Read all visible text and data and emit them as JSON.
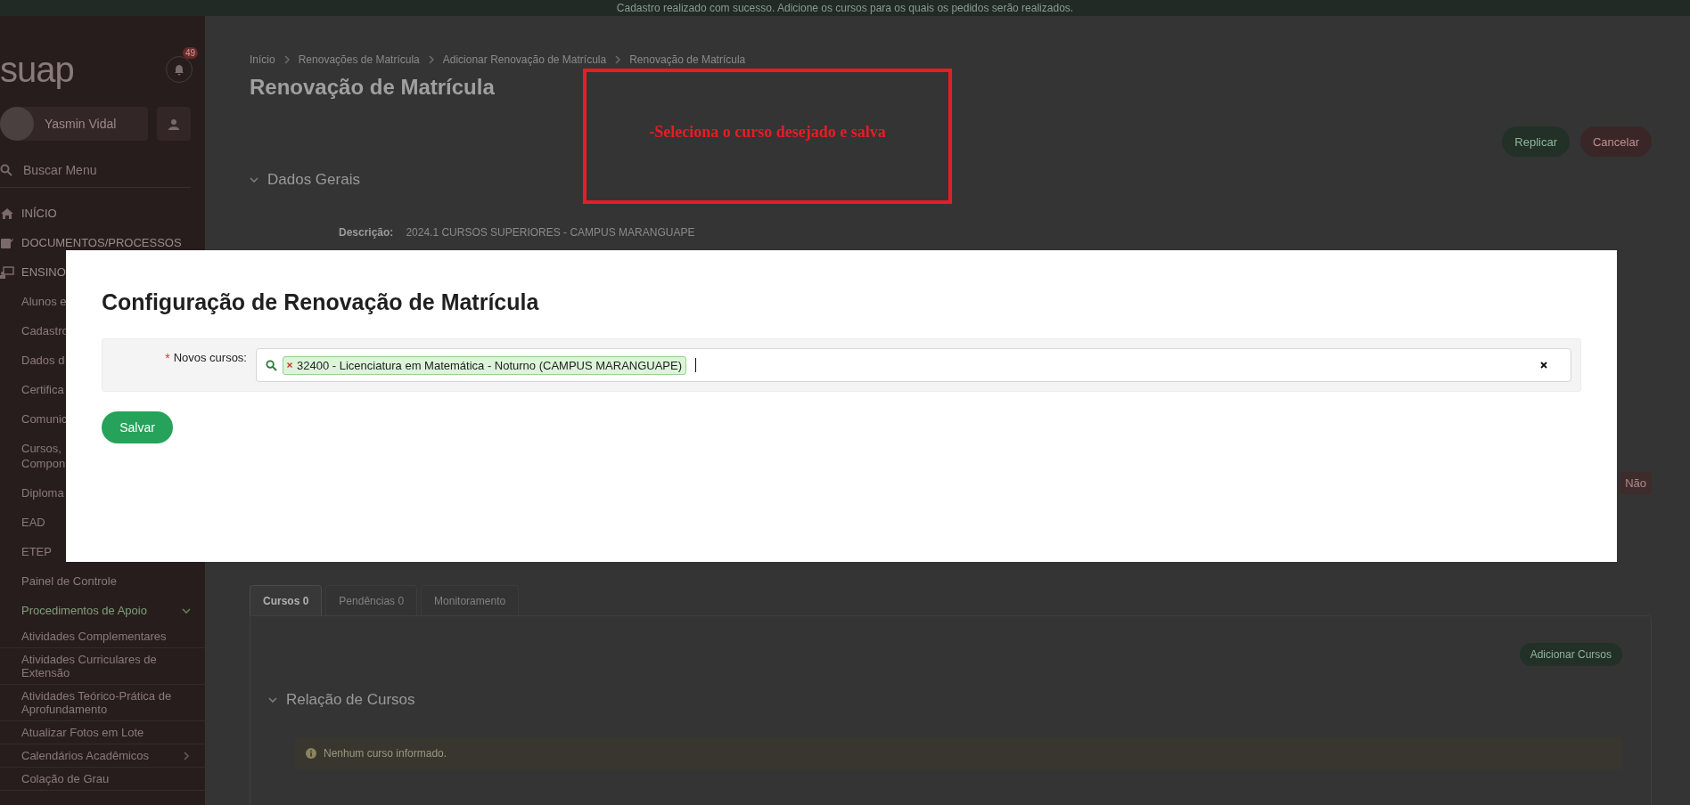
{
  "top_message": "Cadastro realizado com sucesso. Adicione os cursos para os quais os pedidos serão realizados.",
  "sidebar": {
    "logo": "suap",
    "notification_count": "49",
    "user_name": "Yasmin Vidal",
    "search_placeholder": "Buscar Menu",
    "items": [
      {
        "kind": "section",
        "label": "INÍCIO"
      },
      {
        "kind": "section",
        "label": "DOCUMENTOS/PROCESSOS"
      },
      {
        "kind": "section",
        "label": "ENSINO",
        "children": [
          {
            "kind": "link",
            "label": "Alunos e"
          },
          {
            "kind": "link",
            "label": "Cadastro"
          },
          {
            "kind": "link",
            "label": "Dados d"
          },
          {
            "kind": "link",
            "label": "Certifica"
          },
          {
            "kind": "link",
            "label": "Comunic"
          },
          {
            "kind": "link",
            "label": "Cursos,\nCompon"
          },
          {
            "kind": "link",
            "label": "Diploma"
          },
          {
            "kind": "link",
            "label": "EAD"
          },
          {
            "kind": "link",
            "label": "ETEP"
          },
          {
            "kind": "link",
            "label": "Painel de Controle"
          },
          {
            "kind": "group",
            "label": "Procedimentos de Apoio",
            "expanded": true,
            "children": [
              {
                "kind": "link",
                "label": "Atividades Complementares"
              },
              {
                "kind": "link",
                "label": "Atividades Curriculares de Extensão"
              },
              {
                "kind": "link",
                "label": "Atividades Teórico-Prática de Aprofundamento"
              },
              {
                "kind": "link",
                "label": "Atualizar Fotos em Lote"
              },
              {
                "kind": "submenu",
                "label": "Calendários Acadêmicos",
                "expanded": false
              },
              {
                "kind": "link",
                "label": "Colação de Grau"
              }
            ]
          }
        ]
      }
    ]
  },
  "breadcrumbs": [
    "Início",
    "Renovações de Matrícula",
    "Adicionar Renovação de Matrícula",
    "Renovação de Matrícula"
  ],
  "title": "Renovação de Matrícula",
  "actions": [
    {
      "label": "Replicar",
      "kind": "success"
    },
    {
      "label": "Cancelar",
      "kind": "danger"
    }
  ],
  "general_section": {
    "title": "Dados Gerais",
    "expanded": true,
    "fields": [
      {
        "label": "Descrição:",
        "value": "2024.1 CURSOS SUPERIORES - CAMPUS MARANGUAPE"
      }
    ],
    "badge": "Não"
  },
  "tabs": [
    {
      "label": "Cursos 0",
      "selected": true
    },
    {
      "label": "Pendências 0",
      "selected": false
    },
    {
      "label": "Monitoramento",
      "selected": false
    }
  ],
  "tab_panel": {
    "button": "Adicionar Cursos",
    "section_title": "Relação de Cursos",
    "expanded": true,
    "alert": "Nenhum curso informado."
  },
  "modal": {
    "title": "Configuração de Renovação de Matrícula",
    "field": {
      "required_mark": "*",
      "label": "Novos cursos:",
      "tags": [
        "32400 - Licenciatura em Matemática - Noturno (CAMPUS MARANGUAPE)"
      ]
    },
    "submit": "Salvar"
  },
  "annotation": {
    "text": "-Seleciona o curso desejado e salva"
  }
}
